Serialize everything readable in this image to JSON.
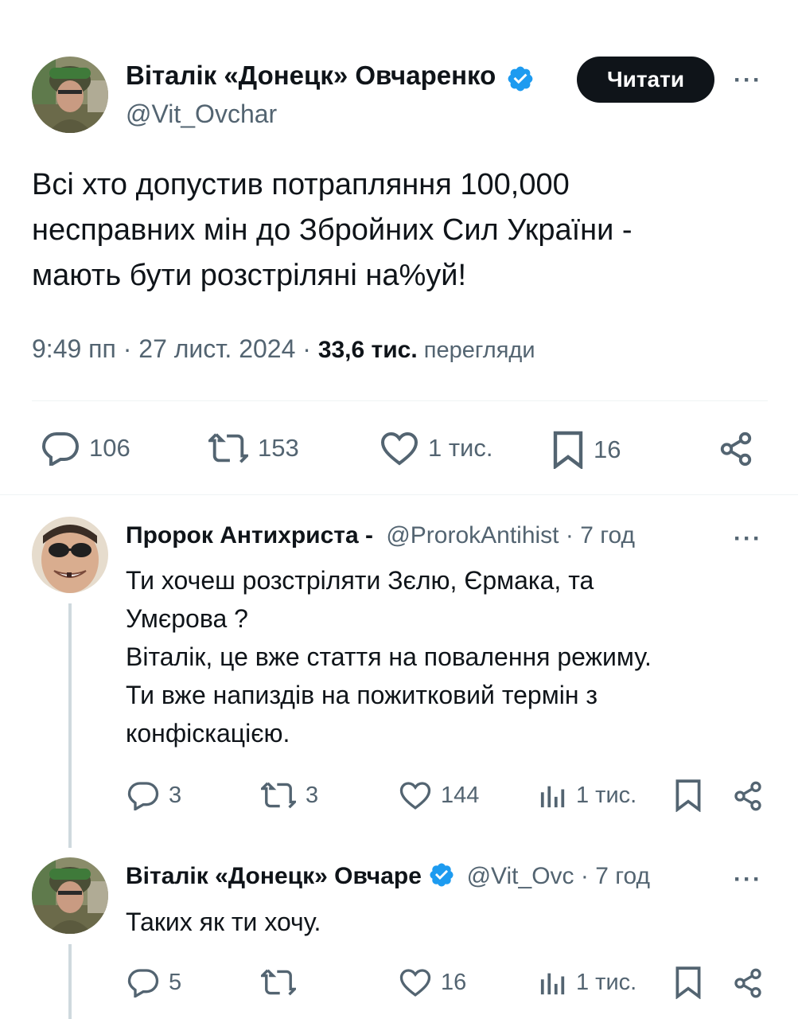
{
  "main_tweet": {
    "author_name": "Віталік «Донецк» Овчаренко",
    "handle": "@Vit_Ovchar",
    "follow_label": "Читати",
    "more": "···",
    "text": "Всі хто допустив потрапляння 100,000\nнесправних мін до Збройних Сил України -\nмають бути розстріляні на%уй!",
    "time": "9:49 пп · 27 лист. 2024 · ",
    "views_count": "33,6 тис.",
    "views_label": " перегляди",
    "actions": {
      "replies": "106",
      "reposts": "153",
      "likes": "1 тис.",
      "bookmarks": "16"
    }
  },
  "replies": [
    {
      "author_name": "Пророк Антихриста -",
      "handle": "@ProrokAntihist",
      "time": " · 7 год",
      "more": "···",
      "text": "Ти хочеш розстріляти Зєлю, Єрмака, та\nУмєрова ?\nВіталік, це вже стаття на повалення режиму.\nТи вже напиздів на пожитковий термін з\nконфіскацією.",
      "actions": {
        "replies": "3",
        "reposts": "3",
        "likes": "144",
        "views": "1 тис."
      }
    },
    {
      "author_name": "Віталік «Донецк» Овчаре",
      "handle": "@Vit_Ovc",
      "time": " · 7 год",
      "more": "···",
      "text": "Таких як ти хочу.",
      "actions": {
        "replies": "5",
        "reposts": "",
        "likes": "16",
        "views": "1 тис."
      }
    }
  ],
  "colors": {
    "verified": "#1d9bf0",
    "text": "#0f1419",
    "secondary": "#536471",
    "divider": "#eff3f4"
  }
}
